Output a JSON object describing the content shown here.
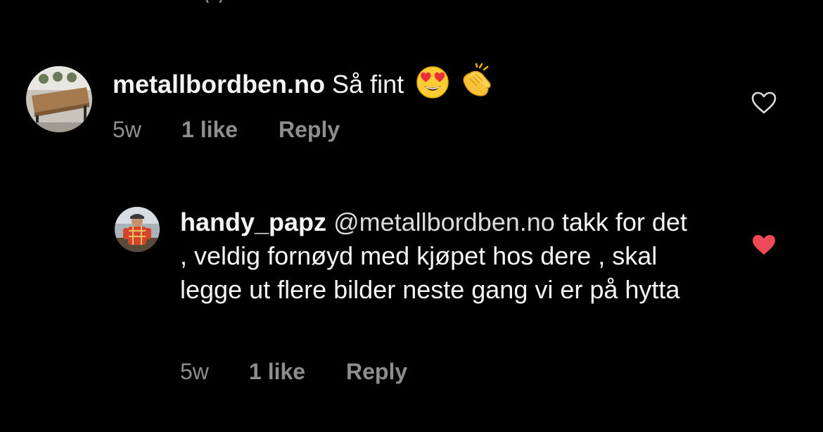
{
  "top_remnant": "( )",
  "colors": {
    "background": "#000000",
    "text": "#f5f5f5",
    "meta": "#8e8e8e",
    "heart_liked": "#ed4956",
    "heart_outline": "#dbdbdb"
  },
  "comments": [
    {
      "username": "metallbordben.no",
      "text": "Så fint",
      "emojis": [
        "heart-eyes-emoji",
        "clapping-hands-emoji"
      ],
      "time": "5w",
      "likes": "1 like",
      "reply_label": "Reply",
      "liked": false
    },
    {
      "username": "handy_papz",
      "mention": "@metallbordben.no",
      "text": "takk for det , veldig fornøyd med kjøpet hos dere , skal legge ut flere bilder neste gang vi er på hytta",
      "time": "5w",
      "likes": "1 like",
      "reply_label": "Reply",
      "liked": true
    }
  ]
}
